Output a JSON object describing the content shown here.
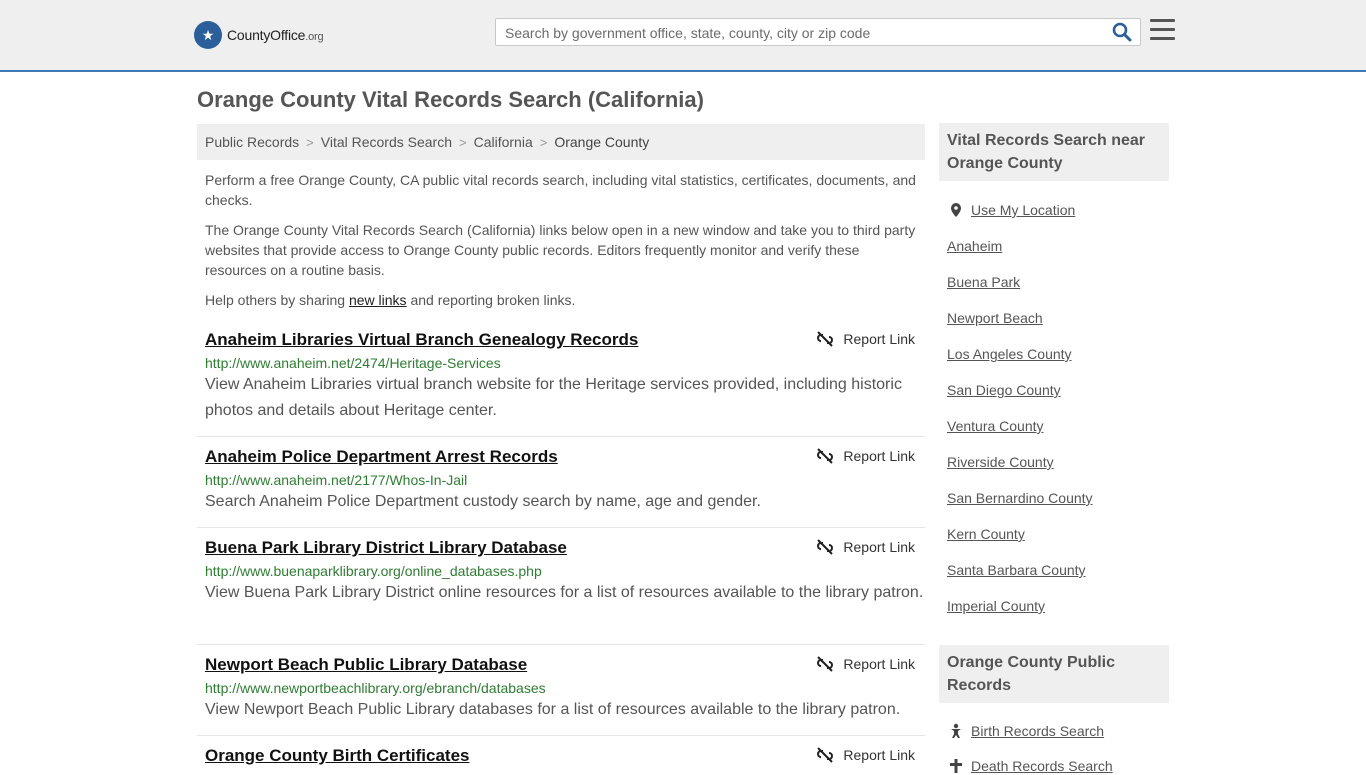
{
  "header": {
    "brand_main": "CountyOffice",
    "brand_suffix": ".org",
    "search_placeholder": "Search by government office, state, county, city or zip code"
  },
  "page_title": "Orange County Vital Records Search (California)",
  "breadcrumb": [
    "Public Records",
    "Vital Records Search",
    "California",
    "Orange County"
  ],
  "intro": {
    "p1": "Perform a free Orange County, CA public vital records search, including vital statistics, certificates, documents, and checks.",
    "p2": "The Orange County Vital Records Search (California) links below open in a new window and take you to third party websites that provide access to Orange County public records. Editors frequently monitor and verify these resources on a routine basis.",
    "p3_before": "Help others by sharing ",
    "p3_link": "new links",
    "p3_after": " and reporting broken links."
  },
  "report_label": "Report Link",
  "results": [
    {
      "title": "Anaheim Libraries Virtual Branch Genealogy Records",
      "url": "http://www.anaheim.net/2474/Heritage-Services",
      "desc": "View Anaheim Libraries virtual branch website for the Heritage services provided, including historic photos and details about Heritage center."
    },
    {
      "title": "Anaheim Police Department Arrest Records",
      "url": "http://www.anaheim.net/2177/Whos-In-Jail",
      "desc": "Search Anaheim Police Department custody search by name, age and gender."
    },
    {
      "title": "Buena Park Library District Library Database",
      "url": "http://www.buenaparklibrary.org/online_databases.php",
      "desc": "View Buena Park Library District online resources for a list of resources available to the library patron."
    },
    {
      "title": "Newport Beach Public Library Database",
      "url": "http://www.newportbeachlibrary.org/ebranch/databases",
      "desc": "View Newport Beach Public Library databases for a list of resources available to the library patron."
    },
    {
      "title": "Orange County Birth Certificates",
      "url": "",
      "desc": ""
    }
  ],
  "sidebar": {
    "near_heading": "Vital Records Search near Orange County",
    "use_location": "Use My Location",
    "near_links": [
      "Anaheim",
      "Buena Park",
      "Newport Beach",
      "Los Angeles County",
      "San Diego County",
      "Ventura County",
      "Riverside County",
      "San Bernardino County",
      "Kern County",
      "Santa Barbara County",
      "Imperial County"
    ],
    "public_heading": "Orange County Public Records",
    "public_links": [
      "Birth Records Search",
      "Death Records Search"
    ]
  }
}
